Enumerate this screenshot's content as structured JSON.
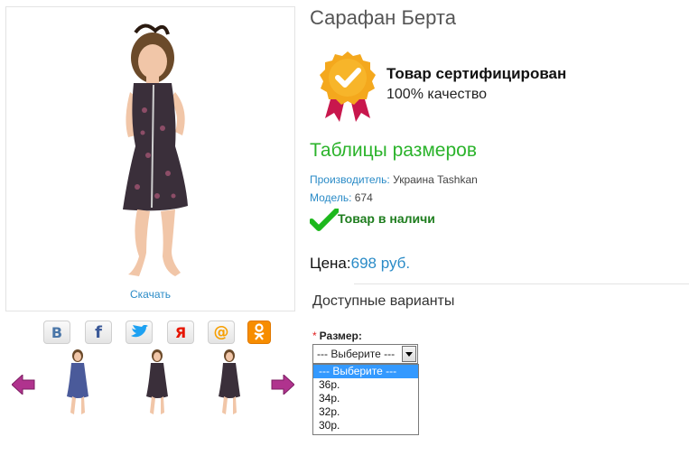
{
  "product": {
    "title": "Сарафан Берта",
    "download_label": "Скачать"
  },
  "certificate": {
    "title": "Товар сертифицирован",
    "subtitle": "100% качество"
  },
  "size_table_link": "Таблицы размеров",
  "meta": {
    "manufacturer_label": "Производитель:",
    "manufacturer_value": "Украина Tashkan",
    "model_label": "Модель:",
    "model_value": "674"
  },
  "stock_status": "Товар в наличи",
  "price": {
    "label": "Цена:",
    "value": "698 руб."
  },
  "variants_heading": "Доступные варианты",
  "size_option": {
    "label": "Размер:",
    "required_mark": "*",
    "selected": "--- Выберите ---",
    "options": [
      "--- Выберите ---",
      "36р.",
      "34р.",
      "32р.",
      "30р."
    ]
  },
  "social": [
    {
      "name": "vkontakte",
      "glyph": "В",
      "color": "#4a76a8"
    },
    {
      "name": "facebook",
      "glyph": "f",
      "color": "#3b5998"
    },
    {
      "name": "twitter",
      "glyph": "t",
      "color": "#1da1f2"
    },
    {
      "name": "yandex",
      "glyph": "Я",
      "color": "#e61400"
    },
    {
      "name": "mail",
      "glyph": "@",
      "color": "#f79f00"
    },
    {
      "name": "odnoklassniki",
      "glyph": "ок",
      "color": "#f78d00"
    }
  ],
  "colors": {
    "accent_blue": "#2a8bc7",
    "green": "#2bb32b",
    "dress": "#3a2f3a"
  }
}
